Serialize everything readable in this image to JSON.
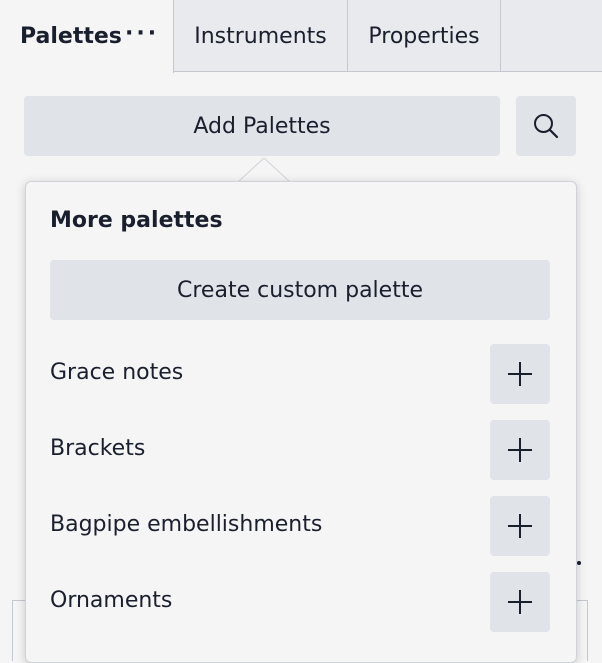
{
  "tabs": {
    "palettes": "Palettes",
    "palettes_menu": "···",
    "instruments": "Instruments",
    "properties": "Properties"
  },
  "toolbar": {
    "add_palettes": "Add Palettes",
    "search_icon": "search-icon"
  },
  "popup": {
    "title": "More palettes",
    "create_custom": "Create custom palette",
    "items": [
      {
        "label": "Grace notes",
        "icon": "plus-icon"
      },
      {
        "label": "Brackets",
        "icon": "plus-icon"
      },
      {
        "label": "Bagpipe embellishments",
        "icon": "plus-icon"
      },
      {
        "label": "Ornaments",
        "icon": "plus-icon"
      }
    ]
  },
  "colors": {
    "background": "#f5f5f5",
    "button": "#e0e3e8",
    "text": "#1a1f2e",
    "border": "#c4c8d0"
  }
}
